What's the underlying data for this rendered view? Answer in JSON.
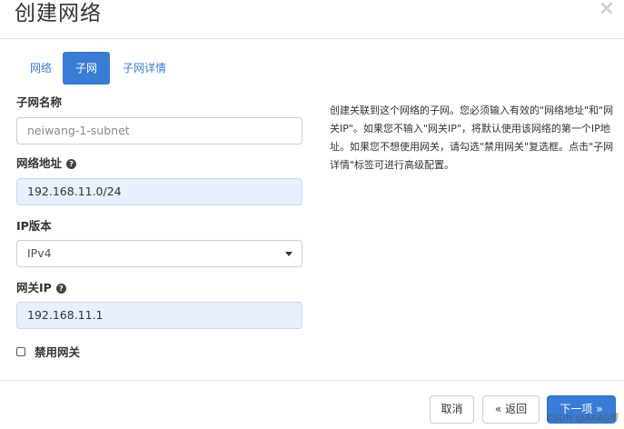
{
  "modal": {
    "title": "创建网络",
    "close_label": "×"
  },
  "tabs": [
    {
      "label": "网络",
      "active": false
    },
    {
      "label": "子网",
      "active": true
    },
    {
      "label": "子网详情",
      "active": false
    }
  ],
  "form": {
    "subnet_name": {
      "label": "子网名称",
      "placeholder": "neiwang-1-subnet",
      "value": ""
    },
    "network_address": {
      "label": "网络地址",
      "value": "192.168.11.0/24",
      "help_icon": "question-circle-icon"
    },
    "ip_version": {
      "label": "IP版本",
      "selected": "IPv4"
    },
    "gateway_ip": {
      "label": "网关IP",
      "value": "192.168.11.1",
      "help_icon": "question-circle-icon"
    },
    "disable_gateway": {
      "label": "禁用网关",
      "checked": false
    }
  },
  "description": {
    "text": "创建关联到这个网络的子网。您必须输入有效的\"网络地址\"和\"网关IP\"。如果您不输入\"网关IP\"，将默认使用该网络的第一个IP地址。如果您不想使用网关，请勾选\"禁用网关\"复选框。点击\"子网详情\"标签可进行高级配置。"
  },
  "footer": {
    "cancel_label": "取消",
    "back_label": "« 返回",
    "next_label": "下一项 »"
  },
  "watermark": "CSDN @AAA0博",
  "colors": {
    "primary": "#3a7bd5",
    "tab_link": "#3f7ad0",
    "autofill_bg": "#e8f0fe"
  }
}
